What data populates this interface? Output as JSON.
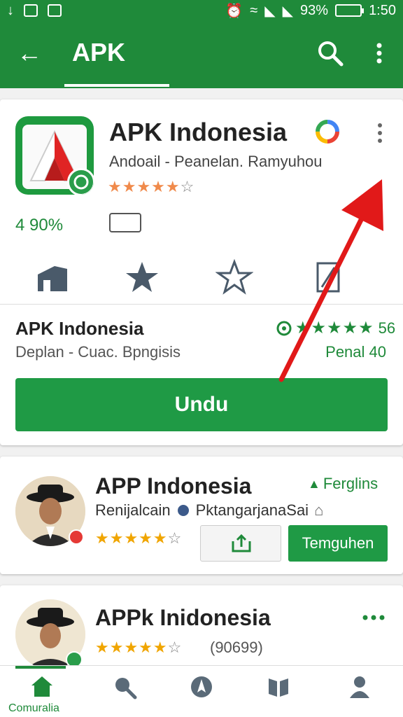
{
  "status_bar": {
    "battery": "93%",
    "time": "1:50"
  },
  "app_bar": {
    "title": "APK",
    "back_icon": "arrow-left-icon",
    "search_icon": "search-icon",
    "more_icon": "more-vert-icon"
  },
  "featured": {
    "title": "APK Indonesia",
    "subtitle": "Andoail - Peanelan. Ramyuhou",
    "stars": "★★★★★☆",
    "percentage": "4 90%",
    "section_title": "APK Indonesia",
    "section_subtitle": "Deplan - Cuac. Bpngisis",
    "rating_stars": "★★★★★",
    "rating_count": "56",
    "penal": "Penal 40",
    "install_button": "Undu"
  },
  "list_items": [
    {
      "title": "APP Indonesia",
      "tag": "Ferglins",
      "subtitle": "Renijalcain",
      "subtitle2": "PktangarjanaSai",
      "stars": "★★★★★☆",
      "action": "Temguhen"
    },
    {
      "title": "APPk Inidonesia",
      "stars": "★★★★★☆",
      "count": "(90699)"
    }
  ],
  "bottom_nav": {
    "active_label": "Comuralia"
  },
  "colors": {
    "primary": "#1f8a3a",
    "accent_star": "#f0a500",
    "arrow": "#e11919"
  }
}
